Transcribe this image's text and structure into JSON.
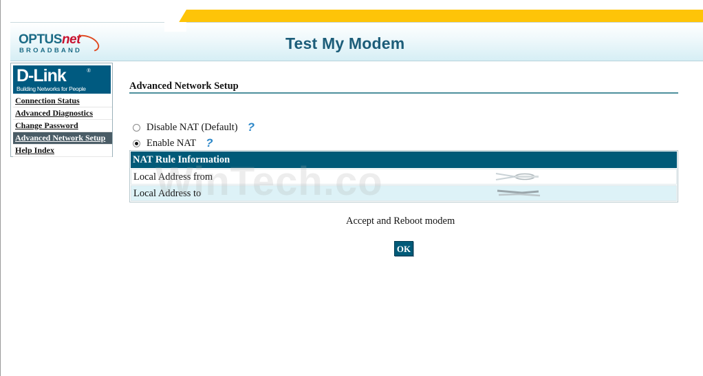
{
  "header": {
    "brand": "OPTUS",
    "brand_net": "net",
    "brand_sub": "BROADBAND",
    "title": "Test My Modem"
  },
  "sidebar": {
    "logo": {
      "name": "D-Link",
      "reg": "®",
      "tagline": "Building Networks for People"
    },
    "items": [
      {
        "label": "Connection Status"
      },
      {
        "label": "Advanced Diagnostics"
      },
      {
        "label": "Change Password"
      },
      {
        "label": "Advanced Network Setup",
        "active": true
      },
      {
        "label": "Help Index"
      }
    ]
  },
  "main": {
    "section_title": "Advanced Network Setup",
    "nat_options": [
      {
        "label": "Disable NAT (Default)",
        "checked": false,
        "help_icon": "question-mark-icon"
      },
      {
        "label": "Enable NAT",
        "checked": true,
        "help_icon": "question-mark-icon"
      }
    ],
    "nat_table": {
      "header": "NAT Rule Information",
      "rows": [
        {
          "label": "Local Address from",
          "value": ""
        },
        {
          "label": "Local Address to",
          "value": ""
        }
      ]
    },
    "reboot_text": "Accept and Reboot modem",
    "ok_label": "OK"
  },
  "watermark": "WinTech.co",
  "colors": {
    "accent": "#005a78",
    "yellow": "#fec408",
    "title_blue": "#1c5d79",
    "help_blue": "#2a86c8"
  }
}
